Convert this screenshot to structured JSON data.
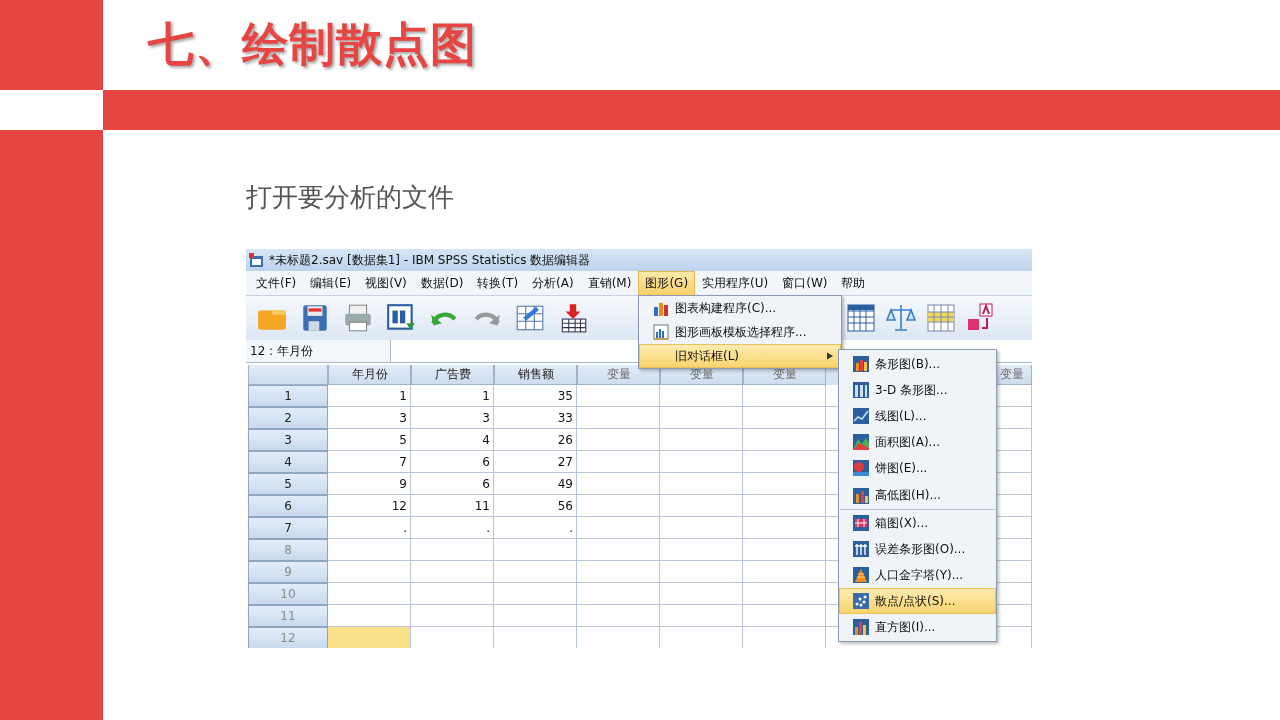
{
  "slide": {
    "title": "七、绘制散点图",
    "subtitle": "打开要分析的文件"
  },
  "window": {
    "title": "*未标题2.sav [数据集1] - IBM SPSS Statistics 数据编辑器",
    "menubar": [
      {
        "label": "文件(F)",
        "selected": false
      },
      {
        "label": "编辑(E)",
        "selected": false
      },
      {
        "label": "视图(V)",
        "selected": false
      },
      {
        "label": "数据(D)",
        "selected": false
      },
      {
        "label": "转换(T)",
        "selected": false
      },
      {
        "label": "分析(A)",
        "selected": false
      },
      {
        "label": "直销(M)",
        "selected": false
      },
      {
        "label": "图形(G)",
        "selected": true
      },
      {
        "label": "实用程序(U)",
        "selected": false
      },
      {
        "label": "窗口(W)",
        "selected": false
      },
      {
        "label": "帮助",
        "selected": false
      }
    ],
    "cell_reference": "12 : 年月份",
    "table": {
      "columns": [
        {
          "header": "年月份"
        },
        {
          "header": "广告费"
        },
        {
          "header": "销售额"
        },
        {
          "header": "变量"
        },
        {
          "header": "变量"
        },
        {
          "header": "变量"
        },
        {},
        {},
        {
          "header": "变量"
        }
      ],
      "rows": [
        {
          "label": "1",
          "empty": false,
          "cells": [
            {
              "value": "1",
              "selected": false
            },
            {
              "value": "1",
              "selected": false
            },
            {
              "value": "35",
              "selected": false
            }
          ]
        },
        {
          "label": "2",
          "empty": false,
          "cells": [
            {
              "value": "3",
              "selected": false
            },
            {
              "value": "3",
              "selected": false
            },
            {
              "value": "33",
              "selected": false
            }
          ]
        },
        {
          "label": "3",
          "empty": false,
          "cells": [
            {
              "value": "5",
              "selected": false
            },
            {
              "value": "4",
              "selected": false
            },
            {
              "value": "26",
              "selected": false
            }
          ]
        },
        {
          "label": "4",
          "empty": false,
          "cells": [
            {
              "value": "7",
              "selected": false
            },
            {
              "value": "6",
              "selected": false
            },
            {
              "value": "27",
              "selected": false
            }
          ]
        },
        {
          "label": "5",
          "empty": false,
          "cells": [
            {
              "value": "9",
              "selected": false
            },
            {
              "value": "6",
              "selected": false
            },
            {
              "value": "49",
              "selected": false
            }
          ]
        },
        {
          "label": "6",
          "empty": false,
          "cells": [
            {
              "value": "12",
              "selected": false
            },
            {
              "value": "11",
              "selected": false
            },
            {
              "value": "56",
              "selected": false
            }
          ]
        },
        {
          "label": "7",
          "empty": false,
          "cells": [
            {
              "value": ".",
              "selected": false
            },
            {
              "value": ".",
              "selected": false
            },
            {
              "value": ".",
              "selected": false
            }
          ]
        },
        {
          "label": "8",
          "empty": true,
          "cells": []
        },
        {
          "label": "9",
          "empty": true,
          "cells": []
        },
        {
          "label": "10",
          "empty": true,
          "cells": []
        },
        {
          "label": "11",
          "empty": true,
          "cells": []
        },
        {
          "label": "12",
          "empty": true,
          "cells": [
            {
              "selected": true
            }
          ]
        }
      ]
    },
    "graphs_menu": [
      {
        "label": "图表构建程序(C)...",
        "selected": false,
        "submenu": false
      },
      {
        "label": "图形画板模板选择程序...",
        "selected": false,
        "submenu": false
      },
      {
        "label": "旧对话框(L)",
        "selected": true,
        "submenu": true
      }
    ],
    "legacy_dialogs_menu": [
      {
        "label": "条形图(B)...",
        "selected": false,
        "separator_after": false
      },
      {
        "label": "3-D 条形图...",
        "selected": false,
        "separator_after": false
      },
      {
        "label": "线图(L)...",
        "selected": false,
        "separator_after": false
      },
      {
        "label": "面积图(A)...",
        "selected": false,
        "separator_after": false
      },
      {
        "label": "饼图(E)...",
        "selected": false,
        "separator_after": false
      },
      {
        "label": "高低图(H)...",
        "selected": false,
        "separator_after": true
      },
      {
        "label": "箱图(X)...",
        "selected": false,
        "separator_after": false
      },
      {
        "label": "误差条形图(O)...",
        "selected": false,
        "separator_after": false
      },
      {
        "label": "人口金字塔(Y)...",
        "selected": false,
        "separator_after": false
      },
      {
        "label": "散点/点状(S)...",
        "selected": true,
        "separator_after": false
      },
      {
        "label": "直方图(I)...",
        "selected": false,
        "separator_after": false
      }
    ]
  }
}
